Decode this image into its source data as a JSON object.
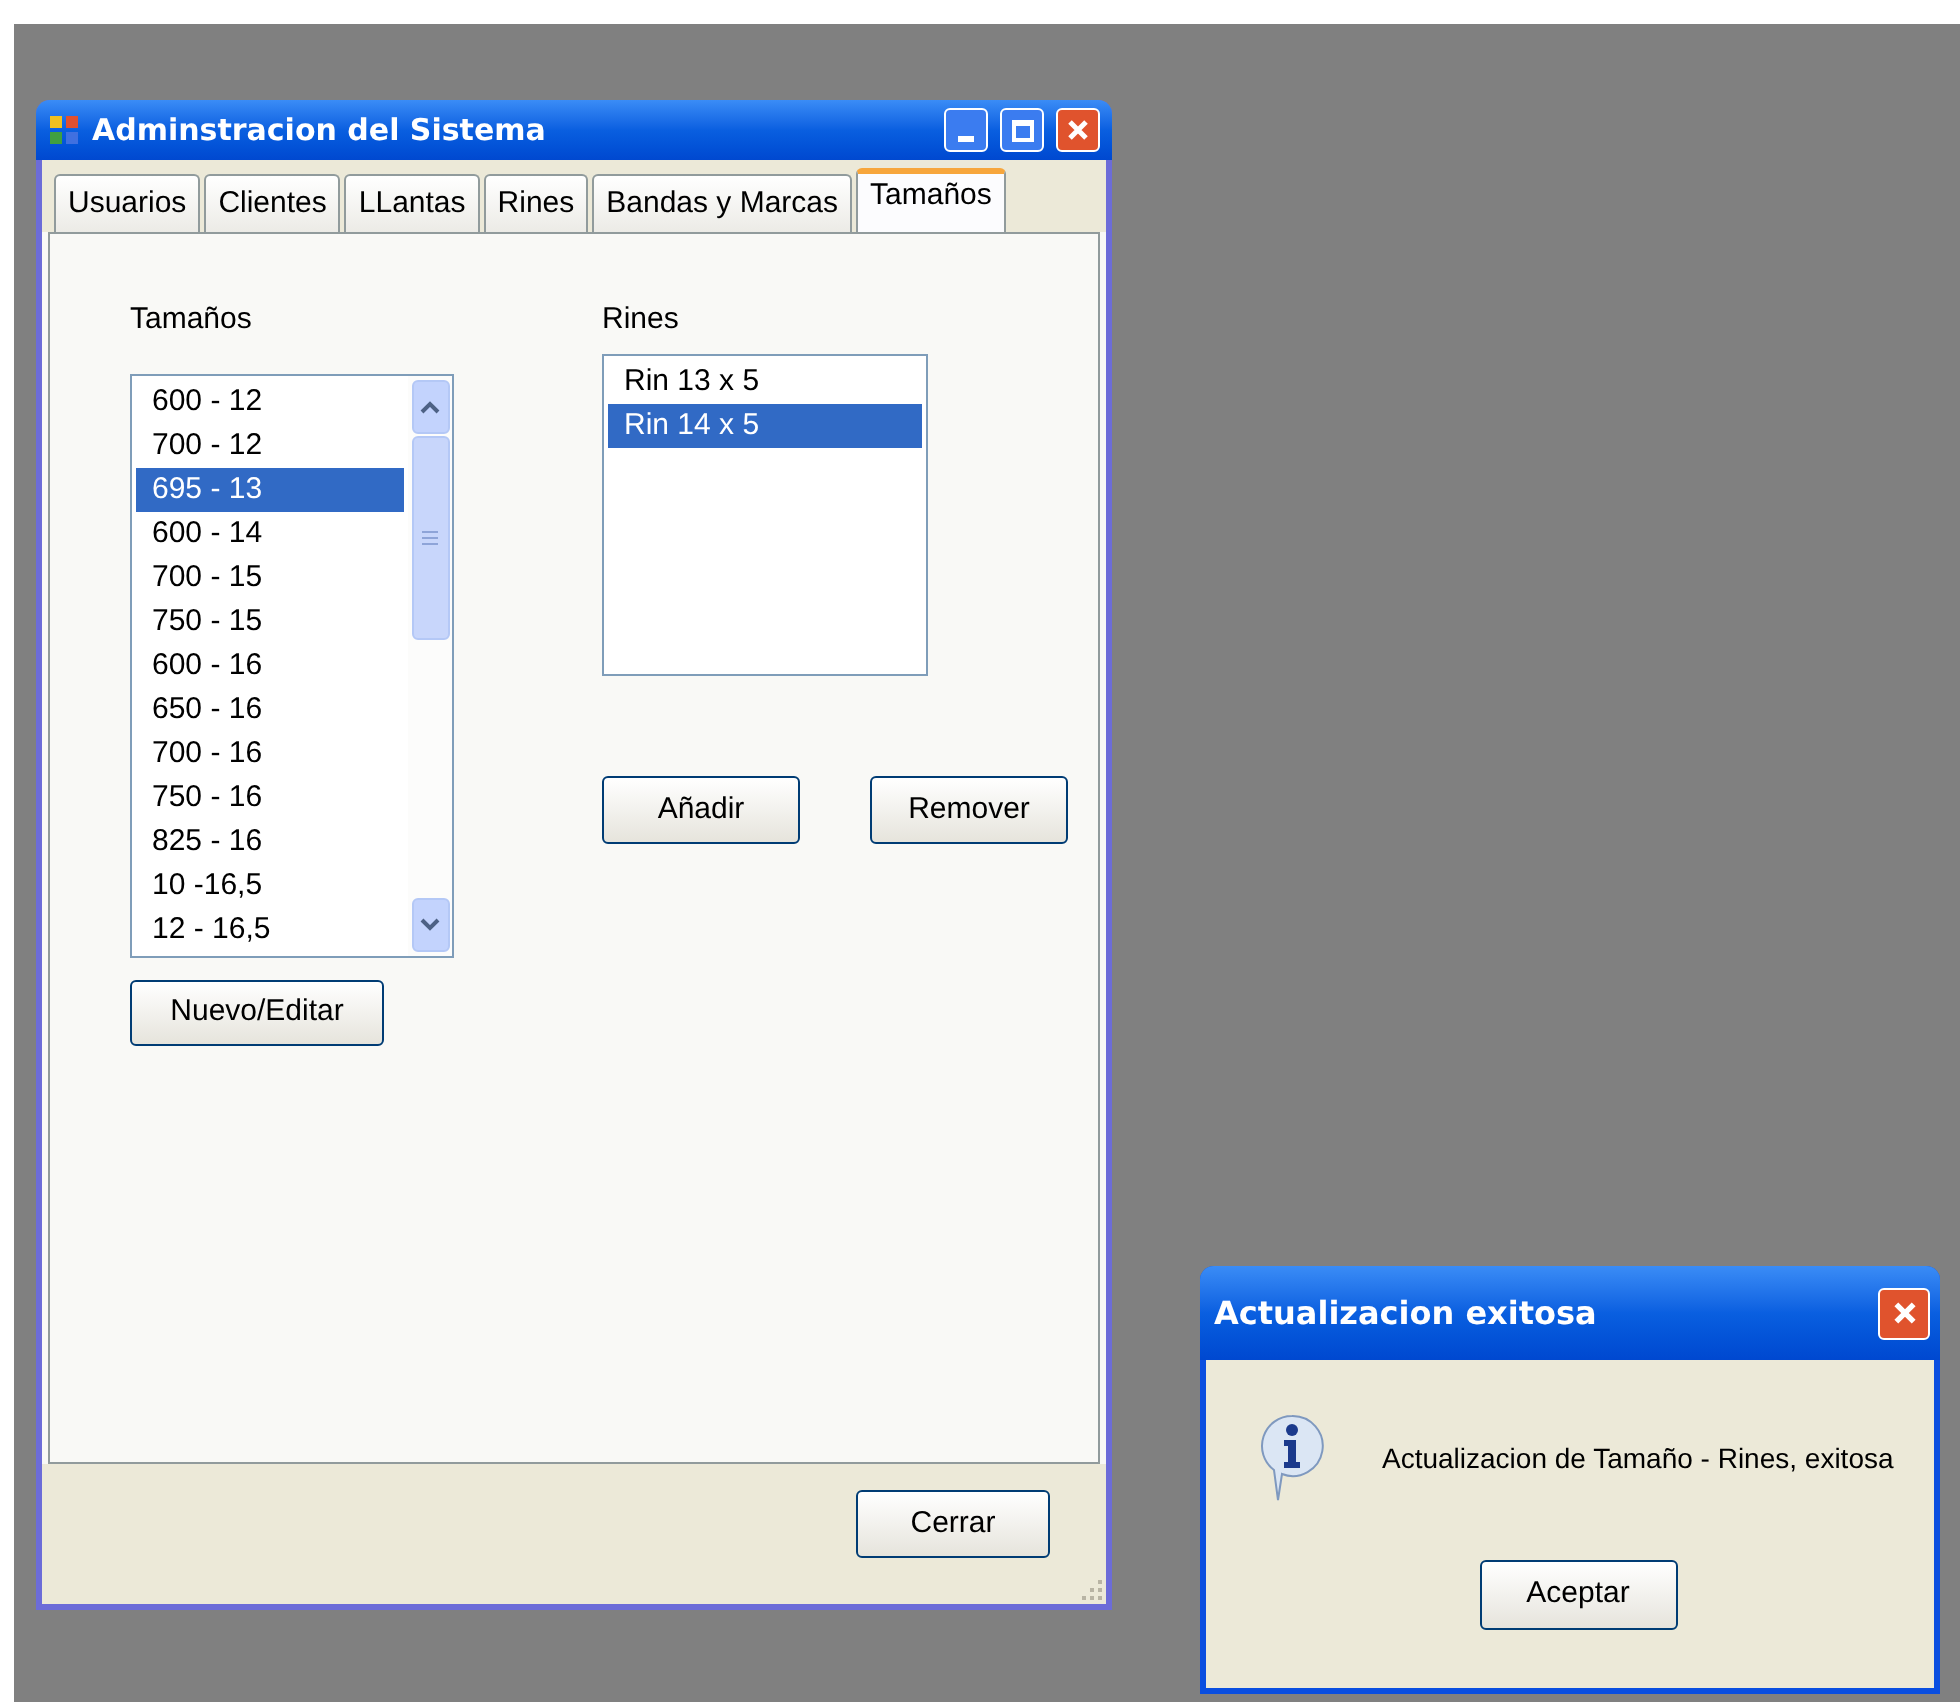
{
  "window": {
    "title": "Adminstracion del Sistema"
  },
  "tabs": [
    {
      "label": "Usuarios",
      "selected": false
    },
    {
      "label": "Clientes",
      "selected": false
    },
    {
      "label": "LLantas",
      "selected": false
    },
    {
      "label": "Rines",
      "selected": false
    },
    {
      "label": "Bandas y Marcas",
      "selected": false
    },
    {
      "label": "Tamaños",
      "selected": true
    }
  ],
  "tamanos": {
    "label": "Tamaños",
    "items": [
      {
        "text": "600 - 12",
        "selected": false
      },
      {
        "text": "700 - 12",
        "selected": false
      },
      {
        "text": "695 - 13",
        "selected": true
      },
      {
        "text": "600 - 14",
        "selected": false
      },
      {
        "text": "700 - 15",
        "selected": false
      },
      {
        "text": "750 - 15",
        "selected": false
      },
      {
        "text": "600 - 16",
        "selected": false
      },
      {
        "text": "650 - 16",
        "selected": false
      },
      {
        "text": "700 - 16",
        "selected": false
      },
      {
        "text": "750 - 16",
        "selected": false
      },
      {
        "text": "825 - 16",
        "selected": false
      },
      {
        "text": "10 -16,5",
        "selected": false
      },
      {
        "text": "12 - 16,5",
        "selected": false
      }
    ],
    "button": "Nuevo/Editar"
  },
  "rines": {
    "label": "Rines",
    "items": [
      {
        "text": "Rin 13 x 5",
        "selected": false
      },
      {
        "text": "Rin 14 x 5",
        "selected": true
      }
    ],
    "buttons": [
      "Añadir",
      "Remover"
    ]
  },
  "close_button": "Cerrar",
  "dialog": {
    "title": "Actualizacion exitosa",
    "message": "Actualizacion de Tamaño - Rines, exitosa",
    "button": "Aceptar"
  }
}
